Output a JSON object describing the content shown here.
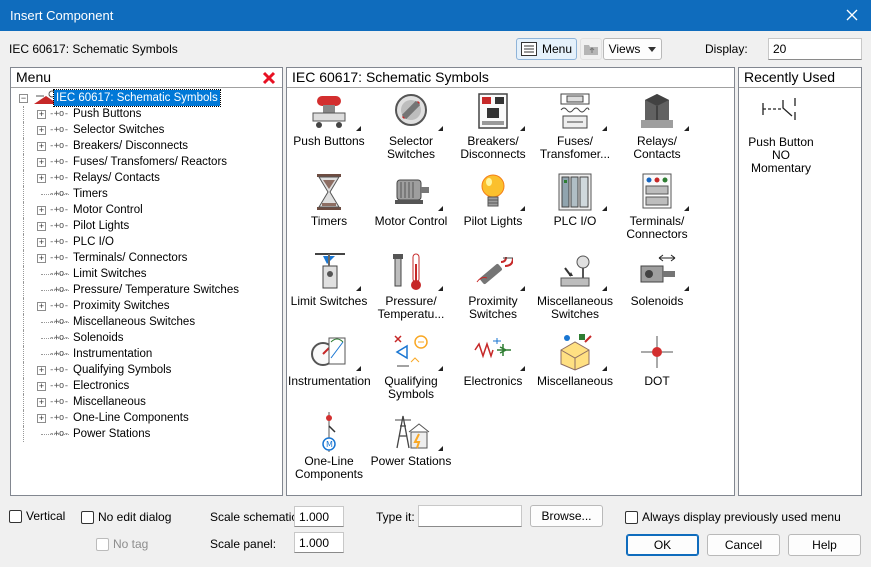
{
  "window": {
    "title": "Insert Component"
  },
  "toolbar": {
    "library_label": "IEC 60617: Schematic Symbols",
    "menu_button": "Menu",
    "views_button": "Views",
    "display_label": "Display:",
    "display_value": "20"
  },
  "menu_panel": {
    "header": "Menu",
    "tree": [
      {
        "label": "IEC 60617: Schematic Symbols",
        "expandable": true,
        "selected": true,
        "root": true
      },
      {
        "label": "Push Buttons",
        "expandable": true
      },
      {
        "label": "Selector Switches",
        "expandable": true
      },
      {
        "label": "Breakers/ Disconnects",
        "expandable": true
      },
      {
        "label": "Fuses/ Transfomers/ Reactors",
        "expandable": true
      },
      {
        "label": "Relays/ Contacts",
        "expandable": true
      },
      {
        "label": "Timers",
        "expandable": false
      },
      {
        "label": "Motor Control",
        "expandable": true
      },
      {
        "label": "Pilot Lights",
        "expandable": true
      },
      {
        "label": "PLC I/O",
        "expandable": true
      },
      {
        "label": "Terminals/ Connectors",
        "expandable": true
      },
      {
        "label": "Limit Switches",
        "expandable": false
      },
      {
        "label": "Pressure/ Temperature Switches",
        "expandable": false
      },
      {
        "label": "Proximity Switches",
        "expandable": true
      },
      {
        "label": "Miscellaneous Switches",
        "expandable": false
      },
      {
        "label": "Solenoids",
        "expandable": false
      },
      {
        "label": "Instrumentation",
        "expandable": false
      },
      {
        "label": "Qualifying Symbols",
        "expandable": true
      },
      {
        "label": "Electronics",
        "expandable": true
      },
      {
        "label": "Miscellaneous",
        "expandable": true
      },
      {
        "label": "One-Line Components",
        "expandable": true
      },
      {
        "label": "Power Stations",
        "expandable": false
      }
    ]
  },
  "symbols_panel": {
    "header": "IEC 60617: Schematic Symbols",
    "tiles": [
      {
        "label": "Push Buttons",
        "icon": "push-button-icon"
      },
      {
        "label": "Selector\nSwitches",
        "icon": "selector-switch-icon"
      },
      {
        "label": "Breakers/\nDisconnects",
        "icon": "breaker-icon"
      },
      {
        "label": "Fuses/\nTransfomer...",
        "icon": "fuse-transformer-icon"
      },
      {
        "label": "Relays/\nContacts",
        "icon": "relay-icon"
      },
      {
        "label": "Timers",
        "icon": "hourglass-icon"
      },
      {
        "label": "Motor Control",
        "icon": "motor-icon"
      },
      {
        "label": "Pilot Lights",
        "icon": "light-bulb-icon"
      },
      {
        "label": "PLC I/O",
        "icon": "plc-icon"
      },
      {
        "label": "Terminals/\nConnectors",
        "icon": "terminal-icon"
      },
      {
        "label": "Limit Switches",
        "icon": "limit-switch-icon"
      },
      {
        "label": "Pressure/\nTemperatu...",
        "icon": "thermometer-icon"
      },
      {
        "label": "Proximity\nSwitches",
        "icon": "proximity-switch-icon"
      },
      {
        "label": "Miscellaneous\nSwitches",
        "icon": "misc-switch-icon"
      },
      {
        "label": "Solenoids",
        "icon": "solenoid-icon"
      },
      {
        "label": "Instrumentation",
        "icon": "gauge-icon"
      },
      {
        "label": "Qualifying\nSymbols",
        "icon": "qualifying-symbols-icon"
      },
      {
        "label": "Electronics",
        "icon": "electronics-icon"
      },
      {
        "label": "Miscellaneous",
        "icon": "misc-box-icon"
      },
      {
        "label": "DOT",
        "icon": "dot-icon"
      },
      {
        "label": "One-Line\nComponents",
        "icon": "one-line-icon"
      },
      {
        "label": "Power Stations",
        "icon": "power-station-icon"
      }
    ]
  },
  "recent_panel": {
    "header": "Recently Used",
    "items": [
      {
        "label": "Push Button NO\nMomentary",
        "icon": "push-button-no-symbol-icon"
      }
    ]
  },
  "options": {
    "vertical": "Vertical",
    "no_edit_dialog": "No edit dialog",
    "no_tag": "No tag",
    "scale_schematic_label": "Scale schematic:",
    "scale_schematic_value": "1.000",
    "scale_panel_label": "Scale panel:",
    "scale_panel_value": "1.000",
    "type_it_label": "Type it:",
    "type_it_value": "",
    "browse_button": "Browse...",
    "always_display": "Always display previously used menu"
  },
  "buttons": {
    "ok": "OK",
    "cancel": "Cancel",
    "help": "Help"
  },
  "colors": {
    "titlebar": "#0f6cbd",
    "selection": "#0078d7",
    "close_red": "#e81123"
  }
}
